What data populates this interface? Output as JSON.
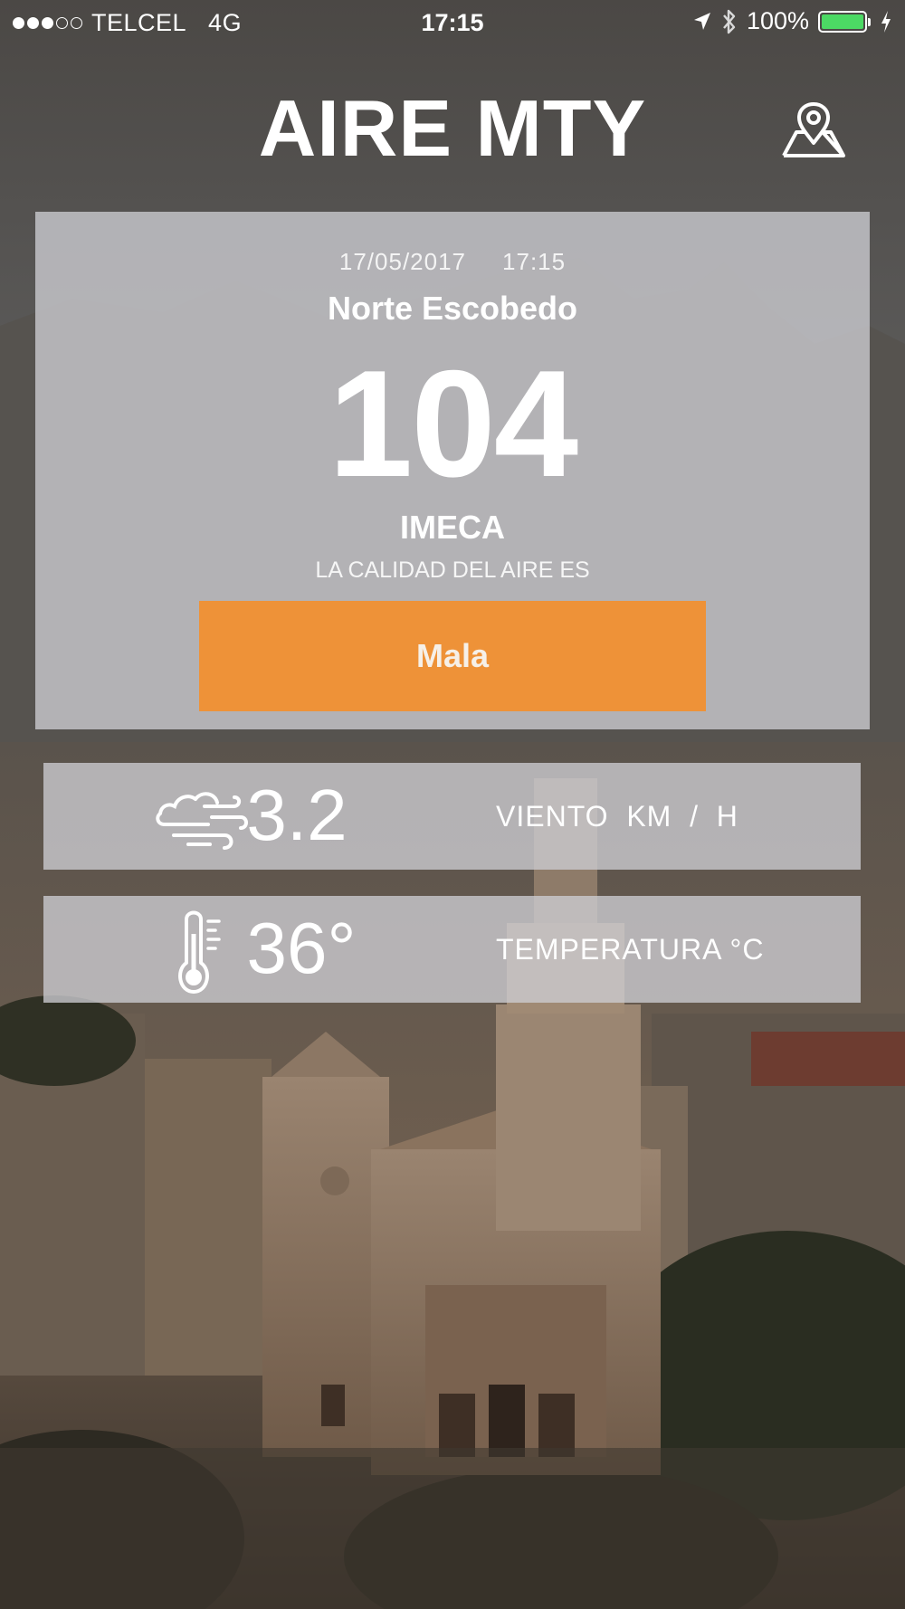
{
  "status_bar": {
    "carrier": "TELCEL",
    "network": "4G",
    "time": "17:15",
    "battery": "100%",
    "battery_color": "#4cd964",
    "icons": [
      "signal-dots",
      "location-arrow-icon",
      "bluetooth-icon",
      "battery-icon",
      "charging-bolt-icon"
    ]
  },
  "header": {
    "title": "AIRE MTY",
    "map_icon": "map-pin-icon"
  },
  "card": {
    "date": "17/05/2017",
    "time": "17:15",
    "station": "Norte Escobedo",
    "aqi_value": "104",
    "aqi_unit": "IMECA",
    "quality_caption": "LA CALIDAD DEL AIRE ES",
    "quality": "Mala",
    "quality_color": "#ee9238"
  },
  "metrics": {
    "wind": {
      "icon": "wind-cloud-icon",
      "value": "3.2",
      "label": "VIENTO  KM  /  H"
    },
    "temperature": {
      "icon": "thermometer-icon",
      "value": "36°",
      "label": "TEMPERATURA °C"
    }
  }
}
